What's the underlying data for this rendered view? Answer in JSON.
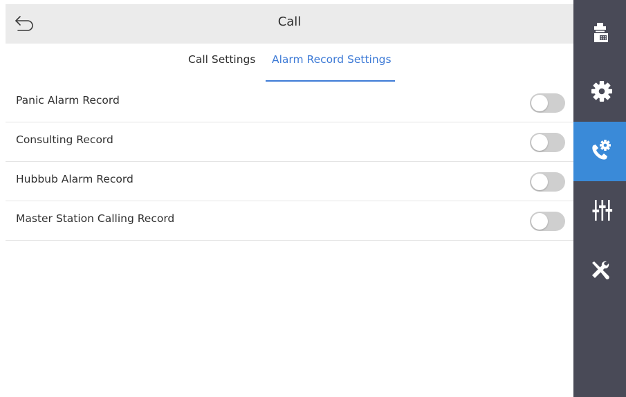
{
  "header": {
    "title": "Call",
    "back_icon": "back-arrow-icon"
  },
  "tabs": [
    {
      "label": "Call Settings",
      "active": false
    },
    {
      "label": "Alarm Record Settings",
      "active": true
    }
  ],
  "settings": [
    {
      "label": "Panic Alarm Record",
      "enabled": false
    },
    {
      "label": "Consulting Record",
      "enabled": false
    },
    {
      "label": "Hubbub Alarm Record",
      "enabled": false
    },
    {
      "label": "Master Station Calling Record",
      "enabled": false
    }
  ],
  "sidebar": {
    "items": [
      {
        "icon": "intercom-device-icon",
        "active": false
      },
      {
        "icon": "gear-icon",
        "active": false
      },
      {
        "icon": "call-settings-icon",
        "active": true
      },
      {
        "icon": "sliders-icon",
        "active": false
      },
      {
        "icon": "tools-icon",
        "active": false
      }
    ]
  },
  "colors": {
    "accent": "#3d7ad6",
    "sidebar": "#494a57",
    "sidebar_active": "#3a8ad8",
    "header": "#ebebeb",
    "toggle_off": "#cfcfcf"
  }
}
